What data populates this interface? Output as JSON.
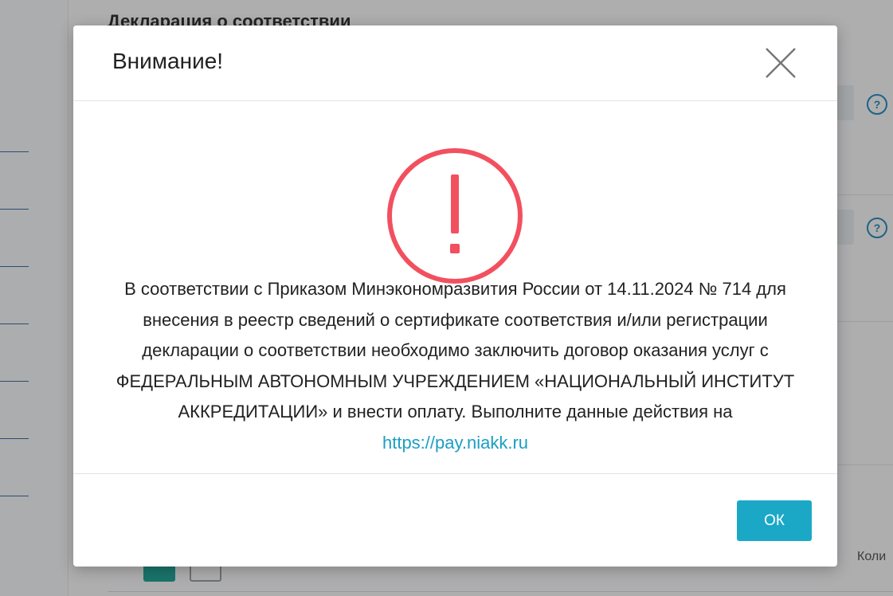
{
  "background": {
    "title": "Декларация о соответствии",
    "help_glyph": "?",
    "qty_label": "Коли"
  },
  "modal": {
    "title": "Внимание!",
    "icon": "exclamation-circle-icon",
    "accent_color": "#f2505f",
    "message_text": "В соответствии с Приказом Минэкономразвития России от 14.11.2024 № 714 для внесения в реестр сведений о сертификате соответствия и/или регистрации декларации о соответствии необходимо заключить договор оказания услуг с ФЕДЕРАЛЬНЫМ АВТОНОМНЫМ УЧРЕЖДЕНИЕМ «НАЦИОНАЛЬНЫЙ ИНСТИТУТ АККРЕДИТАЦИИ» и внести оплату. Выполните данные действия на",
    "link_text": "https://pay.niakk.ru",
    "link_href": "https://pay.niakk.ru",
    "ok_label": "ОК",
    "ok_color": "#1ba8c7"
  }
}
